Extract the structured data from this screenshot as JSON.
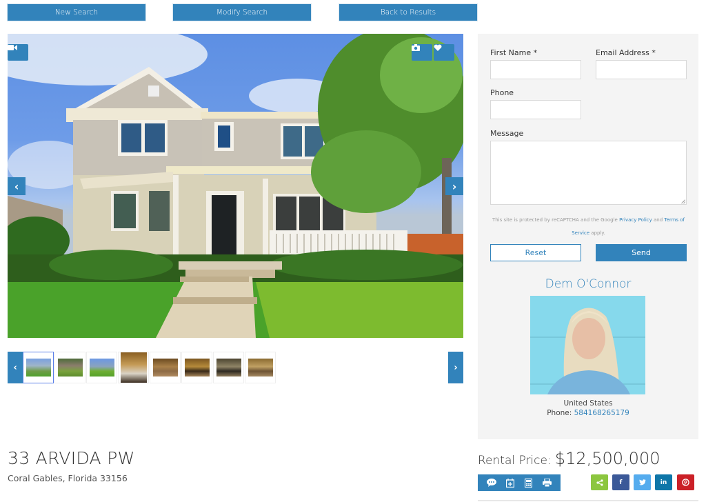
{
  "top_nav": {
    "new_search": "New Search",
    "modify_search": "Modify Search",
    "back_to_results": "Back to Results"
  },
  "gallery": {
    "main_image_alt": "Two-story house with front porch",
    "video_icon": "video-camera-icon",
    "camera_icon": "camera-icon",
    "favorite_icon": "heart-icon",
    "prev_label": "‹",
    "next_label": "›",
    "thumbnails": [
      {
        "label": "Exterior front",
        "active": true
      },
      {
        "label": "Exterior side",
        "active": false
      },
      {
        "label": "Exterior wide",
        "active": false
      },
      {
        "label": "Bathroom",
        "active": false
      },
      {
        "label": "Living room",
        "active": false
      },
      {
        "label": "Kitchen",
        "active": false
      },
      {
        "label": "Family room",
        "active": false
      },
      {
        "label": "Bedroom",
        "active": false
      }
    ]
  },
  "listing": {
    "address": "33 ARVIDA PW",
    "city_state_zip": "Coral Gables, Florida 33156",
    "price_label": "Rental Price:",
    "price": "$12,500,000"
  },
  "contact_form": {
    "first_name_label": "First Name *",
    "first_name_value": "",
    "email_label": "Email Address *",
    "email_value": "",
    "phone_label": "Phone",
    "phone_value": "",
    "message_label": "Message",
    "message_value": "",
    "captcha_text_1": "This site is protected by reCAPTCHA and the Google",
    "privacy_link": "Privacy Policy",
    "captcha_and": "and",
    "terms_link_1": "Terms of",
    "terms_link_2": "Service",
    "captcha_apply": "apply.",
    "reset_label": "Reset",
    "send_label": "Send"
  },
  "agent": {
    "name": "Dem O'Connor",
    "country": "United States",
    "phone_label": "Phone:",
    "phone": "584168265179"
  },
  "tools": [
    "chat-icon",
    "calendar-add-icon",
    "calculator-icon",
    "print-icon"
  ],
  "social": [
    {
      "name": "share",
      "label": "<",
      "color": "#8cc63f"
    },
    {
      "name": "facebook",
      "label": "f",
      "color": "#3b5998"
    },
    {
      "name": "twitter",
      "label": "t",
      "color": "#55acee"
    },
    {
      "name": "linkedin",
      "label": "in",
      "color": "#0e76a8"
    },
    {
      "name": "pinterest",
      "label": "p",
      "color": "#cb2027"
    }
  ],
  "colors": {
    "accent": "#3283bb",
    "panel_bg": "#f4f4f4"
  }
}
